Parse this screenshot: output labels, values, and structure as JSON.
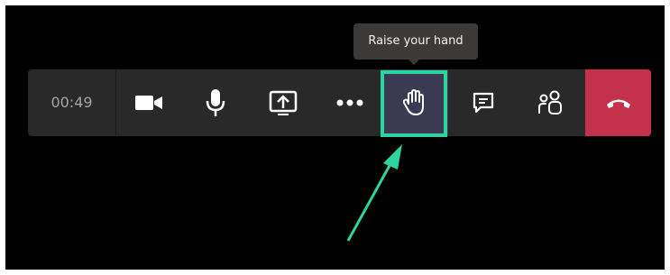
{
  "tooltip": {
    "text": "Raise your hand"
  },
  "call": {
    "timer": "00:49"
  },
  "icons": {
    "camera": "video-camera-icon",
    "mic": "microphone-icon",
    "share": "share-screen-icon",
    "more": "more-actions-icon",
    "hand": "raise-hand-icon",
    "chat": "chat-icon",
    "participants": "participants-icon",
    "hangup": "hang-up-phone-icon"
  },
  "colors": {
    "toolbar": "#292929",
    "highlight": "#2ed4a0",
    "hangup": "#c4314b",
    "hand_active": "#3a3a52"
  }
}
